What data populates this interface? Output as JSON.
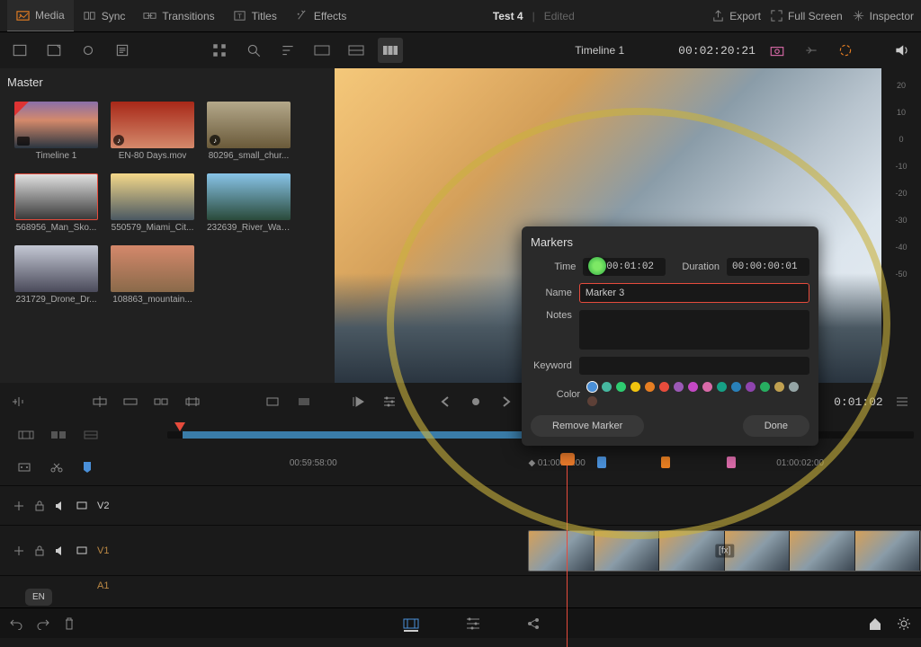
{
  "topbar": {
    "tabs": [
      {
        "label": "Media"
      },
      {
        "label": "Sync"
      },
      {
        "label": "Transitions"
      },
      {
        "label": "Titles"
      },
      {
        "label": "Effects"
      }
    ],
    "project_title": "Test 4",
    "status": "Edited",
    "right": [
      {
        "label": "Export"
      },
      {
        "label": "Full Screen"
      },
      {
        "label": "Inspector"
      }
    ]
  },
  "toolbar2": {
    "timeline_name": "Timeline 1",
    "timecode": "00:02:20:21"
  },
  "mediapool": {
    "bin": "Master",
    "clips": [
      {
        "label": "Timeline 1"
      },
      {
        "label": "EN-80 Days.mov"
      },
      {
        "label": "80296_small_chur..."
      },
      {
        "label": "568956_Man_Sko..."
      },
      {
        "label": "550579_Miami_Cit..."
      },
      {
        "label": "232639_River_Wat..."
      },
      {
        "label": "231729_Drone_Dr..."
      },
      {
        "label": "108863_mountain..."
      }
    ]
  },
  "scopes": {
    "vals": [
      "20",
      "10",
      "0",
      "-10",
      "-20",
      "-30",
      "-40",
      "-50"
    ]
  },
  "markers_panel": {
    "title": "Markers",
    "time_label": "Time",
    "time_value": "01:00:01:02",
    "duration_label": "Duration",
    "duration_value": "00:00:00:01",
    "name_label": "Name",
    "name_value": "Marker 3",
    "notes_label": "Notes",
    "notes_value": "",
    "keyword_label": "Keyword",
    "keyword_value": "",
    "color_label": "Color",
    "colors": [
      "#4a90d9",
      "#46b8a0",
      "#2ecc71",
      "#f1c40f",
      "#e67e22",
      "#e74c3c",
      "#9b59b6",
      "#c448c4",
      "#d96aa8",
      "#16a085",
      "#2980b9",
      "#8e44ad",
      "#27ae60",
      "#c0a050",
      "#95a5a6",
      "#5d4037"
    ],
    "remove_label": "Remove Marker",
    "done_label": "Done"
  },
  "midstrip": {
    "tc_right": "0:01:02"
  },
  "ruler": {
    "ticks": [
      {
        "left": "17%",
        "label": "00:59:58:00"
      },
      {
        "left": "48.4%",
        "label": "01:00:00:00"
      },
      {
        "left": "81%",
        "label": "01:00:02:00"
      }
    ]
  },
  "tracks": {
    "v2": "V2",
    "v1": "V1",
    "a1": "A1"
  },
  "clip_fx": "[fx]",
  "bottombar": {
    "lang": "EN"
  }
}
